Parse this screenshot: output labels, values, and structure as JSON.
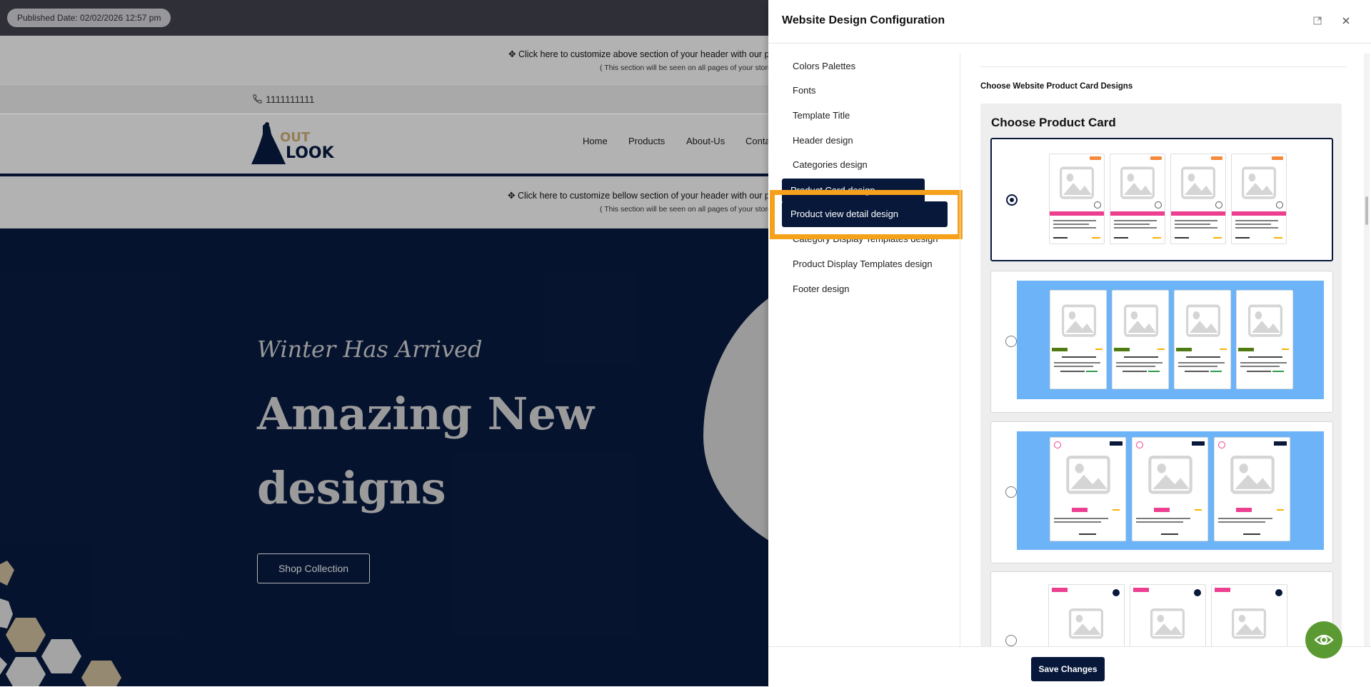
{
  "published": {
    "text": "Published Date: 02/02/2026 12:57 pm"
  },
  "store": {
    "customize_top": "✥ Click here to customize above section of your header with our po",
    "customize_top_note": "( This section will be seen on all pages of your store",
    "phone": "1111111111",
    "logo_text": [
      "OUT",
      "LOOK"
    ],
    "nav": [
      "Home",
      "Products",
      "About-Us",
      "Conta"
    ],
    "customize_bottom": "✥ Click here to customize bellow section of your header with our po",
    "customize_bottom_note": "( This section will be seen on all pages of your store",
    "hero_sub": "Winter Has Arrived",
    "hero_title_1": "Amazing New",
    "hero_title_2": "designs",
    "shop_button": "Shop Collection"
  },
  "drawer": {
    "title": "Website Design Configuration",
    "menu": [
      "Colors Palettes",
      "Fonts",
      "Template Title",
      "Header design",
      "Categories design",
      "Product Card design",
      "Product view detail design",
      "Category Display Templates design",
      "Product Display Templates design",
      "Footer design"
    ],
    "highlighted_item": "Product view detail design",
    "section_label": "Choose Website Product Card Designs",
    "panel_title": "Choose Product Card",
    "save_label": "Save Changes",
    "selected_option": 1
  },
  "colors": {
    "navy": "#07183a",
    "highlight": "#f5a11c",
    "card_blue": "#6cb3f7",
    "pink": "#ec3f8f",
    "fab_green": "#5b9a33"
  },
  "icons": [
    "phone-icon",
    "expand-icon",
    "close-icon",
    "eye-icon",
    "image-placeholder-icon",
    "heart-icon",
    "star-icon"
  ]
}
